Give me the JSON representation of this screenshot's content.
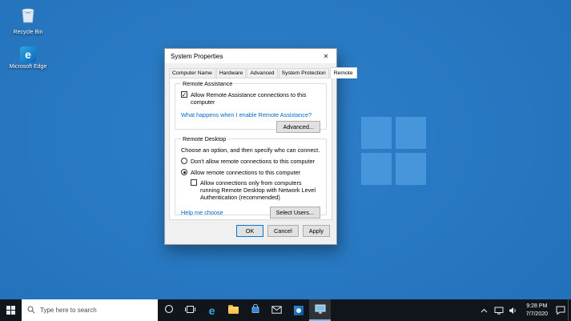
{
  "desktop": {
    "icons": {
      "recycle_bin": "Recycle Bin",
      "edge": "Microsoft Edge"
    }
  },
  "dialog": {
    "title": "System Properties",
    "tabs": [
      {
        "label": "Computer Name"
      },
      {
        "label": "Hardware"
      },
      {
        "label": "Advanced"
      },
      {
        "label": "System Protection"
      },
      {
        "label": "Remote"
      }
    ],
    "active_tab": "Remote",
    "remote_assistance": {
      "group_label": "Remote Assistance",
      "allow_checkbox": {
        "label": "Allow Remote Assistance connections to this computer",
        "checked": true
      },
      "link": "What happens when I enable Remote Assistance?",
      "advanced_button": "Advanced..."
    },
    "remote_desktop": {
      "group_label": "Remote Desktop",
      "description": "Choose an option, and then specify who can connect.",
      "options": [
        {
          "label": "Don't allow remote connections to this computer",
          "selected": false
        },
        {
          "label": "Allow remote connections to this computer",
          "selected": true
        }
      ],
      "nla_checkbox": {
        "label": "Allow connections only from computers running Remote Desktop with Network Level Authentication (recommended)",
        "checked": false
      },
      "help_link": "Help me choose",
      "select_users_button": "Select Users..."
    },
    "footer_buttons": {
      "ok": "OK",
      "cancel": "Cancel",
      "apply": "Apply"
    }
  },
  "taskbar": {
    "search_placeholder": "Type here to search",
    "clock": {
      "time": "9:28 PM",
      "date": "7/7/2020"
    }
  },
  "glyphs": {
    "close": "✕",
    "check": "✓",
    "edge_letter": "e"
  },
  "colors": {
    "accent": "#0078d7",
    "desktop_blue": "#2271bb",
    "link": "#0066cc",
    "taskbar": "#10151b"
  }
}
